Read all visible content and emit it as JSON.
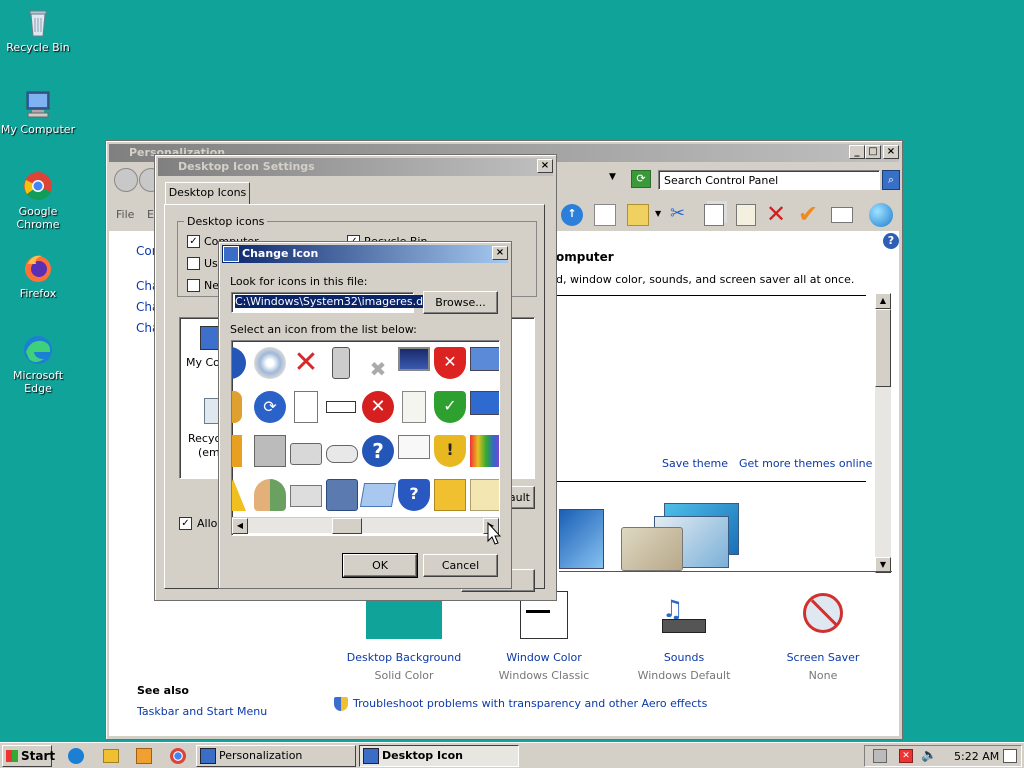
{
  "desktop": {
    "icons": [
      {
        "label": "Recycle Bin",
        "icon": "recycle-bin-icon"
      },
      {
        "label": "My Computer",
        "icon": "computer-icon"
      },
      {
        "label": "Google Chrome",
        "icon": "chrome-icon"
      },
      {
        "label": "Firefox",
        "icon": "firefox-icon"
      },
      {
        "label": "Microsoft Edge",
        "icon": "edge-icon"
      }
    ]
  },
  "personalization": {
    "title": "Personalization",
    "search_placeholder": "Search Control Panel",
    "menu": {
      "file": "File",
      "edit": "E"
    },
    "left_links": [
      "Con",
      "Cha",
      "Cha",
      "Cha"
    ],
    "heading": "omputer",
    "description": "d, window color, sounds, and screen saver all at once.",
    "save_theme": "Save theme",
    "more_themes": "Get more themes online",
    "bottom_items": [
      {
        "title": "Desktop Background",
        "sub": "Solid Color"
      },
      {
        "title": "Window Color",
        "sub": "Windows Classic"
      },
      {
        "title": "Sounds",
        "sub": "Windows Default"
      },
      {
        "title": "Screen Saver",
        "sub": "None"
      }
    ],
    "see_also": "See also",
    "taskbar_link": "Taskbar and Start Menu",
    "troubleshoot_link": "Troubleshoot problems with transparency and other Aero effects"
  },
  "desktop_icon_settings": {
    "title": "Desktop Icon Settings",
    "tab": "Desktop Icons",
    "group": "Desktop icons",
    "checkboxes": [
      {
        "label": "Computer",
        "checked": true
      },
      {
        "label": "Us",
        "checked": false
      },
      {
        "label": "Ne",
        "checked": false
      },
      {
        "label": "Recycle Bin",
        "checked": true
      }
    ],
    "preview_labels": {
      "mycomputer": "My Com",
      "recycle": "Recycl",
      "empty": "(em"
    },
    "restore_default": "ault",
    "allow_label": "Allow",
    "apply": "ply"
  },
  "change_icon": {
    "title": "Change Icon",
    "look_label": "Look for icons in this file:",
    "file_path": "C:\\Windows\\System32\\imageres.dll",
    "browse": "Browse...",
    "select_label": "Select an icon from the list below:",
    "ok": "OK",
    "cancel": "Cancel"
  },
  "taskbar": {
    "start": "Start",
    "items": [
      "Personalization",
      "Desktop Icon Settings"
    ],
    "clock": "5:22 AM"
  }
}
